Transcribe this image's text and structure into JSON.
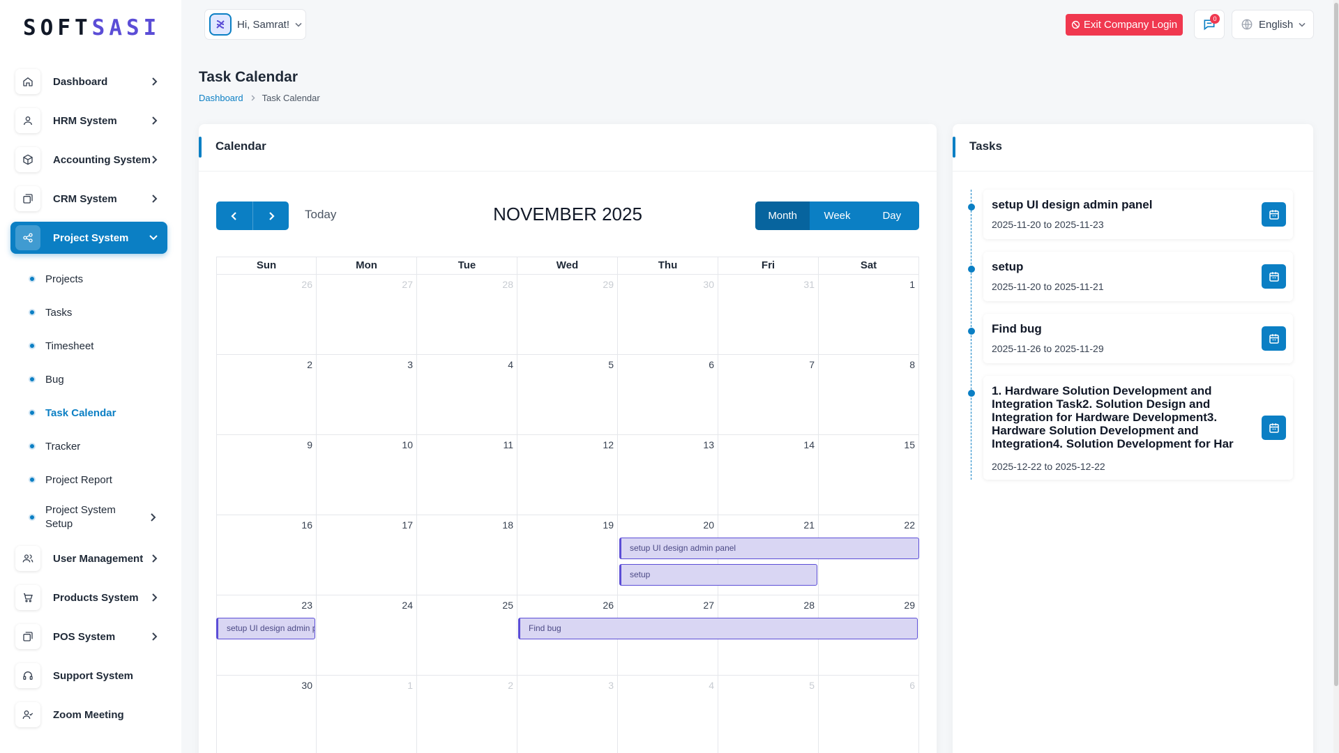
{
  "brand": {
    "logo_left": "SOFT",
    "logo_right": "SASI"
  },
  "topbar": {
    "greeting": "Hi, Samrat!",
    "exit_label": "Exit Company Login",
    "notifications_count": "0",
    "language": "English"
  },
  "sidebar": {
    "items": [
      {
        "label": "Dashboard"
      },
      {
        "label": "HRM System"
      },
      {
        "label": "Accounting System"
      },
      {
        "label": "CRM System"
      },
      {
        "label": "Project System"
      },
      {
        "label": "User Management"
      },
      {
        "label": "Products System"
      },
      {
        "label": "POS System"
      },
      {
        "label": "Support System"
      },
      {
        "label": "Zoom Meeting"
      }
    ],
    "sub_items": [
      {
        "label": "Projects"
      },
      {
        "label": "Tasks"
      },
      {
        "label": "Timesheet"
      },
      {
        "label": "Bug"
      },
      {
        "label": "Task Calendar"
      },
      {
        "label": "Tracker"
      },
      {
        "label": "Project Report"
      },
      {
        "label": "Project System Setup"
      }
    ]
  },
  "page": {
    "title": "Task Calendar",
    "breadcrumb": {
      "home": "Dashboard",
      "current": "Task Calendar"
    }
  },
  "calendar": {
    "card_title": "Calendar",
    "today_label": "Today",
    "month_title": "NOVEMBER 2025",
    "views": {
      "month": "Month",
      "week": "Week",
      "day": "Day"
    },
    "days_of_week": [
      "Sun",
      "Mon",
      "Tue",
      "Wed",
      "Thu",
      "Fri",
      "Sat"
    ],
    "weeks": [
      [
        "26",
        "27",
        "28",
        "29",
        "30",
        "31",
        "1"
      ],
      [
        "2",
        "3",
        "4",
        "5",
        "6",
        "7",
        "8"
      ],
      [
        "9",
        "10",
        "11",
        "12",
        "13",
        "14",
        "15"
      ],
      [
        "16",
        "17",
        "18",
        "19",
        "20",
        "21",
        "22"
      ],
      [
        "23",
        "24",
        "25",
        "26",
        "27",
        "28",
        "29"
      ],
      [
        "30",
        "1",
        "2",
        "3",
        "4",
        "5",
        "6"
      ]
    ],
    "events": [
      {
        "title": "setup UI design admin panel"
      },
      {
        "title": "setup"
      },
      {
        "title": "setup UI design admin panel"
      },
      {
        "title": "Find bug"
      }
    ]
  },
  "tasks": {
    "card_title": "Tasks",
    "items": [
      {
        "title": "setup UI design admin panel",
        "dates": "2025-11-20 to 2025-11-23"
      },
      {
        "title": "setup",
        "dates": "2025-11-20 to 2025-11-21"
      },
      {
        "title": "Find bug",
        "dates": "2025-11-26 to 2025-11-29"
      },
      {
        "title": "1. Hardware Solution Development and Integration Task2. Solution Design and Integration for Hardware Development3. Hardware Solution Development and Integration4. Solution Development for Har",
        "dates": "2025-12-22 to 2025-12-22"
      }
    ]
  },
  "colors": {
    "accent": "#0b7fc4",
    "danger": "#f0384f",
    "event_bg": "#d9d6f3",
    "event_border": "#5b4dd6"
  }
}
